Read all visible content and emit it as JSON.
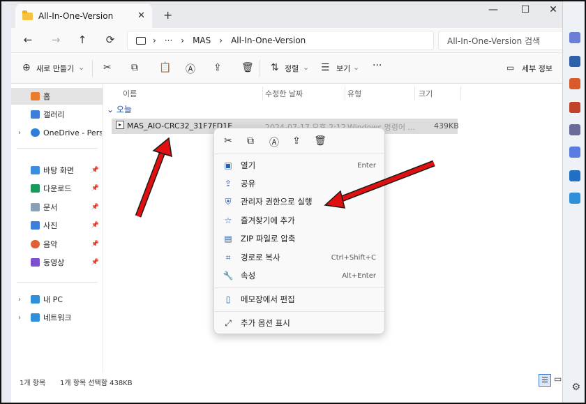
{
  "window": {
    "tab_title": "All-In-One-Version",
    "new_tab": "+",
    "close_tab": "✕",
    "minimize": "—",
    "maximize": "☐",
    "close": "✕"
  },
  "nav": {
    "back": "←",
    "forward": "→",
    "up": "↑",
    "refresh": "⟳",
    "breadcrumb": [
      "MAS",
      "All-In-One-Version"
    ],
    "ellipsis": "···",
    "search_placeholder": "All-In-One-Version 검색"
  },
  "toolbar": {
    "new_label": "새로 만들기",
    "sort_label": "정렬",
    "view_label": "보기",
    "more": "···",
    "details_label": "세부 정보"
  },
  "sidebar": {
    "items": [
      {
        "label": "홈",
        "icon": "home-icon",
        "color": "#e87d2d"
      },
      {
        "label": "갤러리",
        "icon": "gallery-icon",
        "color": "#3d7ed8"
      },
      {
        "label": "OneDrive - Persona",
        "icon": "cloud-icon",
        "color": "#2f7fd6"
      },
      {
        "label": "바탕 화면",
        "icon": "desktop-icon",
        "color": "#3b8de0"
      },
      {
        "label": "다운로드",
        "icon": "download-icon",
        "color": "#1a9a5a"
      },
      {
        "label": "문서",
        "icon": "documents-icon",
        "color": "#8aa0b6"
      },
      {
        "label": "사진",
        "icon": "pictures-icon",
        "color": "#3d7ed8"
      },
      {
        "label": "음악",
        "icon": "music-icon",
        "color": "#e0603a"
      },
      {
        "label": "동영상",
        "icon": "videos-icon",
        "color": "#7b4fd0"
      },
      {
        "label": "내 PC",
        "icon": "pc-icon",
        "color": "#2f8fd9"
      },
      {
        "label": "네트워크",
        "icon": "network-icon",
        "color": "#2f8fd9"
      }
    ]
  },
  "columns": {
    "name": "이름",
    "modified": "수정한 날짜",
    "type": "유형",
    "size": "크기"
  },
  "group_label": "오늘",
  "file": {
    "name": "MAS_AIO-CRC32_31F7FD1E",
    "modified": "2024-07-17 오후 2:12",
    "type": "Windows 명령어 ...",
    "size": "439KB"
  },
  "context_menu": {
    "items": [
      {
        "label": "열기",
        "shortcut": "Enter",
        "icon": "open-icon"
      },
      {
        "label": "공유",
        "shortcut": "",
        "icon": "share-icon"
      },
      {
        "label": "관리자 권한으로 실행",
        "shortcut": "",
        "icon": "admin-shield-icon"
      },
      {
        "label": "즐겨찾기에 추가",
        "shortcut": "",
        "icon": "star-icon"
      },
      {
        "label": "ZIP 파일로 압축",
        "shortcut": "",
        "icon": "zip-icon"
      },
      {
        "label": "경로로 복사",
        "shortcut": "Ctrl+Shift+C",
        "icon": "copy-path-icon"
      },
      {
        "label": "속성",
        "shortcut": "Alt+Enter",
        "icon": "wrench-icon"
      },
      {
        "label": "메모장에서 편집",
        "shortcut": "",
        "icon": "notepad-icon"
      },
      {
        "label": "추가 옵션 표시",
        "shortcut": "",
        "icon": "more-options-icon"
      }
    ]
  },
  "status": {
    "count": "1개 항목",
    "selection": "1개 항목 선택함 438KB"
  },
  "colors": {
    "accent": "#2a5dab",
    "arrow": "#e01010",
    "selected_row": "#dcdcdc"
  }
}
